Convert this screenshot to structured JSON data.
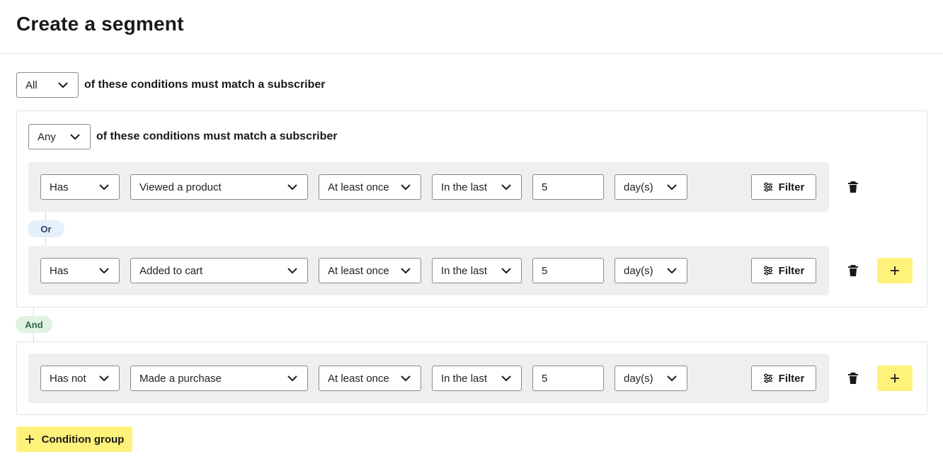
{
  "page": {
    "title": "Create a segment"
  },
  "outer_match": {
    "quantifier": "All",
    "text": "of these conditions must match a subscriber"
  },
  "group1": {
    "match": {
      "quantifier": "Any",
      "text": "of these conditions must match a subscriber"
    },
    "conditions": [
      {
        "has": "Has",
        "event": "Viewed a product",
        "frequency": "At least once",
        "timeframe": "In the last",
        "amount": "5",
        "unit": "day(s)",
        "filter_label": "Filter"
      },
      {
        "has": "Has",
        "event": "Added to cart",
        "frequency": "At least once",
        "timeframe": "In the last",
        "amount": "5",
        "unit": "day(s)",
        "filter_label": "Filter"
      }
    ],
    "connector": "Or"
  },
  "groups_connector": "And",
  "group2": {
    "conditions": [
      {
        "has": "Has not",
        "event": "Made a purchase",
        "frequency": "At least once",
        "timeframe": "In the last",
        "amount": "5",
        "unit": "day(s)",
        "filter_label": "Filter"
      }
    ]
  },
  "add_condition_group_label": "Condition group",
  "icons": {
    "dropdown": "chevron-down-icon",
    "filter": "sliders-icon",
    "delete": "trash-icon",
    "add": "plus-icon"
  },
  "colors": {
    "accent_yellow": "#fff27a",
    "row_bg": "#efefef",
    "or_pill_bg": "#e6f0fb",
    "and_pill_bg": "#dff2e4"
  }
}
